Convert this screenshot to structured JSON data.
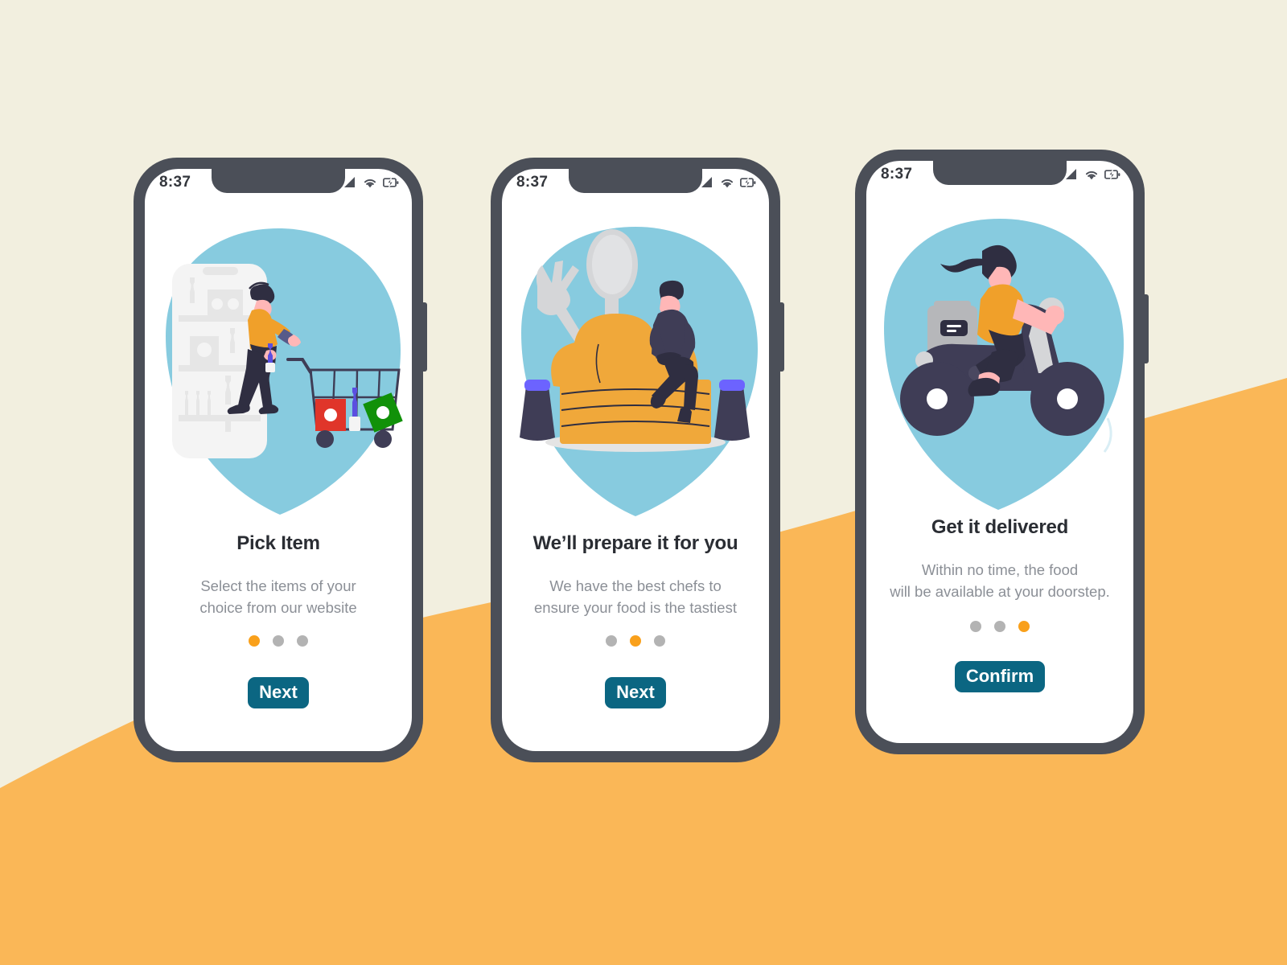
{
  "background": {
    "top_color": "#f2efdf",
    "hill_color": "#fab757"
  },
  "theme": {
    "frame_color": "#4b4f58",
    "screen_bg": "#ffffff",
    "blob_color": "#87cbdf",
    "accent_orange": "#f9a01b",
    "dot_inactive": "#b3b3b3",
    "cta_bg": "#0b6682",
    "cta_text": "#ffffff",
    "title_color": "#2a2d33",
    "subtitle_color": "#8b8f96",
    "skin": "#ffb7b7",
    "hair_dark": "#2f2e41",
    "shirt_orange": "#f0a02a",
    "pants_dark": "#2f2e41"
  },
  "status_bar": {
    "time": "8:37",
    "icons": [
      "signal-icon",
      "wifi-icon",
      "battery-charging-icon"
    ]
  },
  "screens": [
    {
      "id": "pick-item",
      "illustration": "shopping-cart-illustration",
      "title": "Pick Item",
      "subtitle_lines": [
        "Select the items of your",
        "choice from our website"
      ],
      "dots": {
        "count": 3,
        "active_index": 0
      },
      "cta_label": "Next"
    },
    {
      "id": "prepare",
      "illustration": "chef-hat-illustration",
      "title": "We’ll prepare it for you",
      "subtitle_lines": [
        "We have the best chefs to",
        "ensure your food is the tastiest"
      ],
      "dots": {
        "count": 3,
        "active_index": 1
      },
      "cta_label": "Next"
    },
    {
      "id": "delivered",
      "illustration": "scooter-delivery-illustration",
      "title": "Get it delivered",
      "subtitle_lines": [
        "Within no time, the food",
        "will be available at your doorstep."
      ],
      "dots": {
        "count": 3,
        "active_index": 2
      },
      "cta_label": "Confirm"
    }
  ]
}
